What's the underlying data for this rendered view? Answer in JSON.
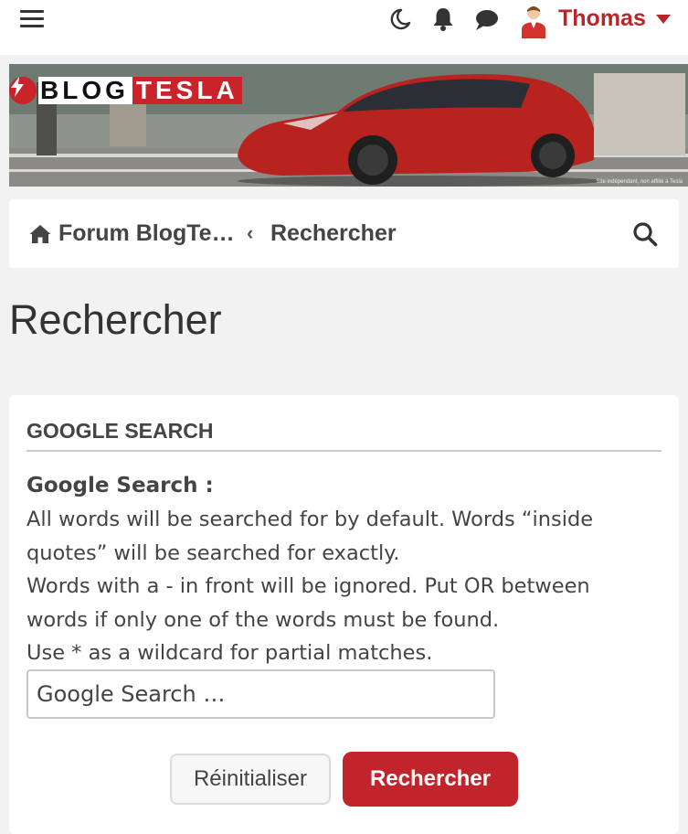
{
  "topbar": {
    "menu_icon": "hamburger-icon",
    "icons": [
      "moon-icon",
      "bell-icon",
      "chat-icon"
    ],
    "user_name": "Thomas",
    "accent": "#b8262a"
  },
  "banner": {
    "logo_blog": "BLOG",
    "logo_tesla": "TESLA",
    "caption": "Site indépendant, non affilié à Tesla"
  },
  "breadcrumb": {
    "forum": "Forum BlogTe…",
    "separator": "‹",
    "current": "Rechercher"
  },
  "page": {
    "title": "Rechercher"
  },
  "panel": {
    "header": "GOOGLE SEARCH",
    "label": "Google Search :",
    "help_lines": [
      "All words will be searched for by default. Words “inside quotes” will be searched for exactly.",
      "Words with a - in front will be ignored. Put OR between words if only one of the words must be found.",
      "Use * as a wildcard for partial matches."
    ],
    "input_placeholder": "Google Search …",
    "input_value": "",
    "reset_label": "Réinitialiser",
    "submit_label": "Rechercher",
    "brand_red": "#c0252b"
  }
}
